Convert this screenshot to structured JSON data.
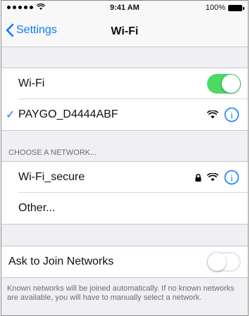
{
  "status_bar": {
    "time": "9:41 AM",
    "battery": "100%",
    "icons": [
      "signal-dots-icon",
      "wifi-icon",
      "battery-icon"
    ]
  },
  "nav": {
    "back_label": "Settings",
    "title": "Wi-Fi"
  },
  "wifi_group": {
    "wifi_label": "Wi-Fi",
    "wifi_enabled": true,
    "connected_network": "PAYGO_D4444ABF"
  },
  "choose_section": {
    "header": "CHOOSE A NETWORK...",
    "networks": [
      {
        "name": "Wi-Fi_secure",
        "locked": true
      },
      {
        "name": "Other..."
      }
    ]
  },
  "ask_group": {
    "label": "Ask to Join Networks",
    "enabled": false,
    "footer": "Known networks will be joined automatically. If no known networks are available, you will have to manually select a network."
  },
  "colors": {
    "accent": "#0a7aff",
    "toggle_on": "#4cd964",
    "background": "#efeff4"
  }
}
